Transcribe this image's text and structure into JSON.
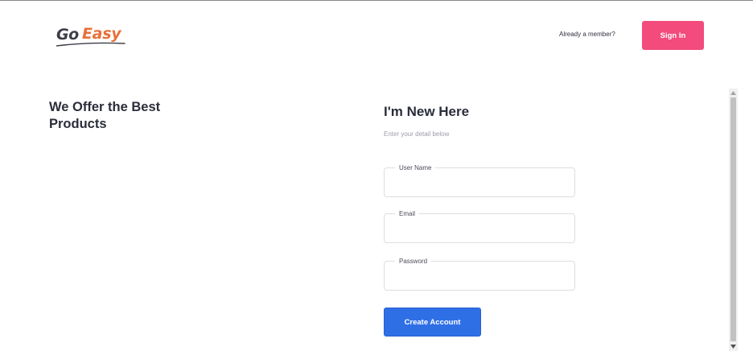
{
  "header": {
    "logo": {
      "go": "Go",
      "easy": "Easy"
    },
    "member_prompt": "Already a member?",
    "signin_label": "Sign In"
  },
  "hero": {
    "title": "We Offer the Best Products"
  },
  "form": {
    "title": "I'm New Here",
    "subtitle": "Enter your detail below",
    "fields": [
      {
        "label": "User Name",
        "value": "",
        "type": "text"
      },
      {
        "label": "Email",
        "value": "",
        "type": "email"
      },
      {
        "label": "Password",
        "value": "",
        "type": "password"
      }
    ],
    "submit_label": "Create Account"
  },
  "colors": {
    "signin_bg": "#f24b7c",
    "create_bg": "#2f6fe6",
    "logo_accent": "#e8703a",
    "logo_dark": "#3d3e48"
  }
}
